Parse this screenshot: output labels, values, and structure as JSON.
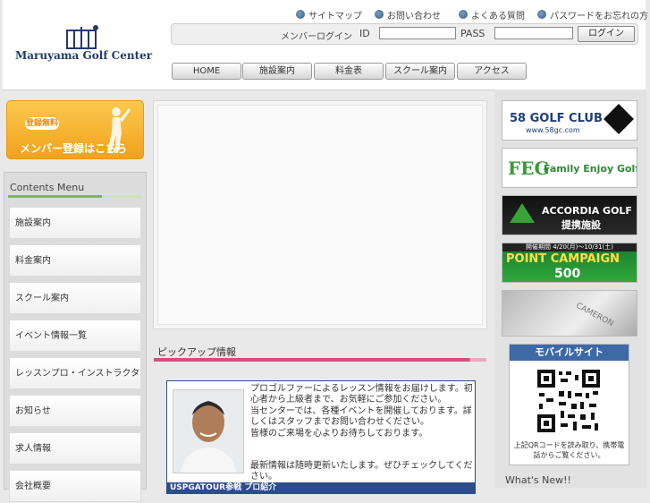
{
  "header": {
    "logo_text": "Maruyama Golf Center",
    "top_links": [
      "サイトマップ",
      "お問い合わせ",
      "よくある質問",
      "パスワードをお忘れの方"
    ],
    "login": {
      "label": "メンバーログイン",
      "id_label": "ID",
      "pass_label": "PASS",
      "button": "ログイン"
    },
    "nav": [
      "HOME",
      "施設案内",
      "料金表",
      "スクール案内",
      "アクセス"
    ]
  },
  "left": {
    "member_banner": {
      "badge": "登録無料",
      "text": "メンバー登録はこちら"
    },
    "contents_title": "Contents Menu",
    "menu": [
      "施設案内",
      "料金案内",
      "スクール案内",
      "イベント情報一覧",
      "レッスンプロ・インストラクター紹介",
      "お知らせ",
      "求人情報",
      "会社概要"
    ]
  },
  "center": {
    "pickup_title": "ピックアップ情報",
    "pickup_text": [
      "プロゴルファーによるレッスン情報をお届けします。初心者から上級者まで、お気軽にご参加ください。",
      "当センターでは、各種イベントを開催しております。詳しくはスタッフまでお問い合わせください。",
      "皆様のご来場を心よりお待ちしております。",
      "最新情報は随時更新いたします。ぜひチェックしてください。"
    ],
    "pickup_footer": "USPGATOUR参戦 プロ紹介"
  },
  "right": {
    "ads": {
      "ad1": {
        "text": "58 GOLF CLUB",
        "url": "www.58gc.com"
      },
      "ad2": {
        "mark": "FEG",
        "text": "Family Enjoy Golf"
      },
      "ad3": {
        "text": "ACCORDIA GOLF",
        "sub": "提携施設"
      },
      "ad4": {
        "top": "開催期間 4/20(月)～10/31(土)",
        "text": "POINT CAMPAIGN",
        "sub": "500"
      },
      "ad5": {
        "text": "CAMERON"
      }
    },
    "mobile": {
      "title": "モバイルサイト",
      "note": "上記QRコードを読み取り、携帯電話からご覧ください。"
    },
    "whats_new": "What's New!!"
  },
  "colors": {
    "nav_blue": "#233a6e",
    "contents_green": "#7db94a",
    "pickup_pink": "#c9537f",
    "mobile_blue": "#3d69a6",
    "banner_orange": "#f2a21a"
  }
}
